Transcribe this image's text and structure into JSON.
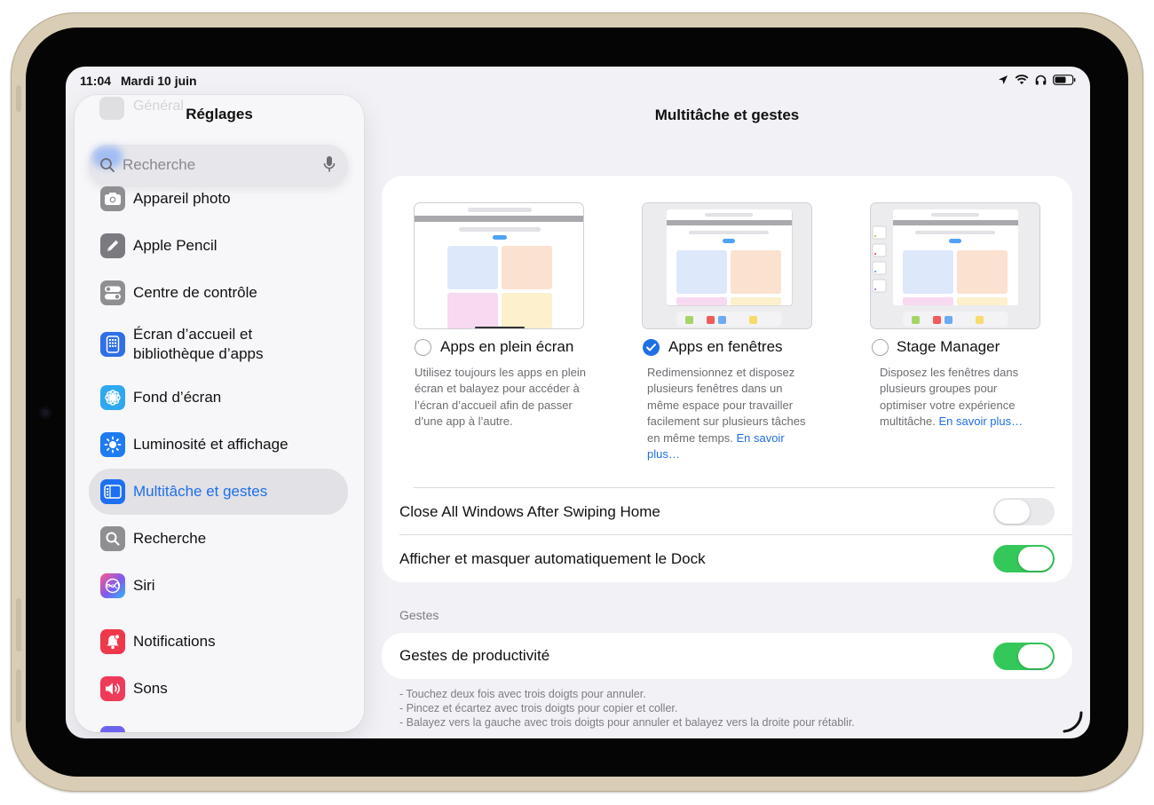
{
  "status": {
    "time": "11:04",
    "date": "Mardi 10 juin"
  },
  "sidebar": {
    "title": "Réglages",
    "ghost_item": "Général",
    "search_placeholder": "Recherche",
    "items": [
      {
        "label": "Appareil photo",
        "icon": "camera-icon",
        "color": "#8e8e93"
      },
      {
        "label": "Apple Pencil",
        "icon": "pencil-icon",
        "color": "#7a7a80"
      },
      {
        "label": "Centre de contrôle",
        "icon": "control-center-icon",
        "color": "#8e8e93"
      },
      {
        "label": "Écran d’accueil et bibliothèque d’apps",
        "icon": "home-screen-icon",
        "color": "#2f6fe8"
      },
      {
        "label": "Fond d’écran",
        "icon": "flower-icon",
        "color": "#30a8f0"
      },
      {
        "label": "Luminosité et affichage",
        "icon": "sun-icon",
        "color": "#1e7bf2"
      },
      {
        "label": "Multitâche et gestes",
        "icon": "multitasking-icon",
        "color": "#1e6ff2",
        "selected": true
      },
      {
        "label": "Recherche",
        "icon": "search-icon",
        "color": "#8e8e93"
      },
      {
        "label": "Siri",
        "icon": "siri-icon",
        "color": "#7b5cf0"
      },
      {
        "label": "Notifications",
        "icon": "bell-icon",
        "color": "#f0384b"
      },
      {
        "label": "Sons",
        "icon": "speaker-icon",
        "color": "#f03a5a"
      }
    ]
  },
  "main": {
    "title": "Multitâche et gestes",
    "modes": [
      {
        "label": "Apps en plein écran",
        "checked": false,
        "desc": "Utilisez toujours les apps en plein écran et balayez pour accéder à l’écran d’accueil afin de passer d’une app à l’autre.",
        "link": ""
      },
      {
        "label": "Apps en fenêtres",
        "checked": true,
        "desc": "Redimensionnez et disposez plusieurs fenêtres dans un même espace pour travailler facilement sur plusieurs tâches en même temps.",
        "link": "En savoir plus…"
      },
      {
        "label": "Stage Manager",
        "checked": false,
        "desc": "Disposez les fenêtres dans plusieurs groupes pour optimiser votre expérience multitâche.",
        "link": "En savoir plus…"
      }
    ],
    "rows": [
      {
        "label": "Close All Windows After Swiping Home",
        "on": false
      },
      {
        "label": "Afficher et masquer automatiquement le Dock",
        "on": true
      }
    ],
    "gestures_header": "Gestes",
    "gestures_row": {
      "label": "Gestes de productivité",
      "on": true
    },
    "footnotes": [
      "- Touchez deux fois avec trois doigts pour annuler.",
      "- Pincez et écartez avec trois doigts pour copier et coller.",
      "- Balayez vers la gauche avec trois doigts pour annuler et balayez vers la droite pour rétablir."
    ]
  },
  "colors": {
    "accent": "#1f6fe5",
    "toggle_on": "#34c759",
    "toggle_off": "#e9e9ec"
  }
}
